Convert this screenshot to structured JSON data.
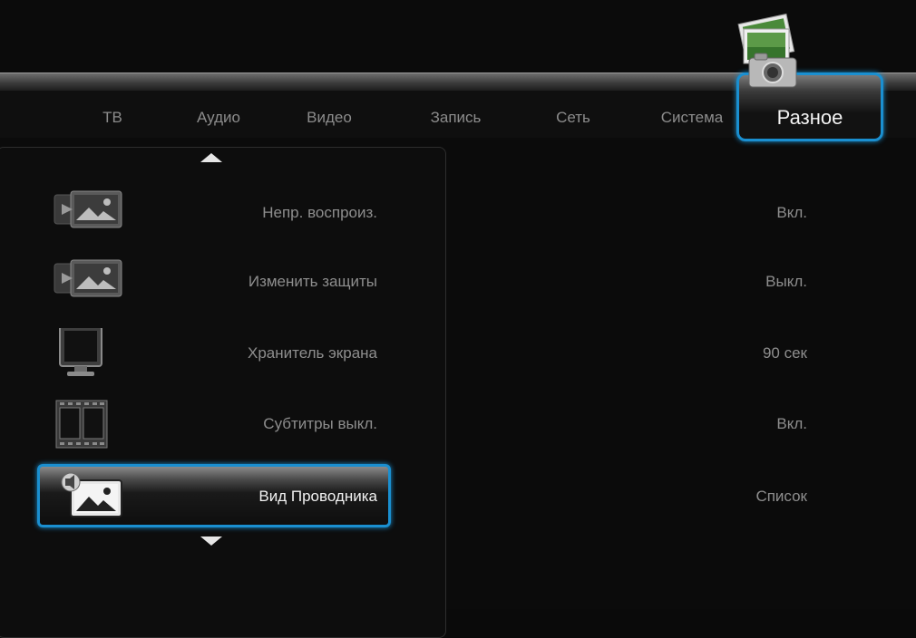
{
  "tabs": [
    {
      "label": "ТВ"
    },
    {
      "label": "Аудио"
    },
    {
      "label": "Видео"
    },
    {
      "label": "Запись"
    },
    {
      "label": "Сеть"
    },
    {
      "label": "Система"
    }
  ],
  "active_tab": {
    "label": "Разное",
    "icon": "photo-camera-icon"
  },
  "accent_color": "#1a8fd0",
  "settings": [
    {
      "label": "Непр. воспроиз.",
      "value": "Вкл.",
      "icon": "slideshow-icon"
    },
    {
      "label": "Изменить защиты",
      "value": "Выкл.",
      "icon": "slideshow-icon"
    },
    {
      "label": "Хранитель экрана",
      "value": "90 сек",
      "icon": "monitor-icon"
    },
    {
      "label": "Субтитры выкл.",
      "value": "Вкл.",
      "icon": "film-icon"
    },
    {
      "label": "Вид Проводника",
      "value": "Список",
      "icon": "browser-view-icon",
      "selected": true
    }
  ]
}
